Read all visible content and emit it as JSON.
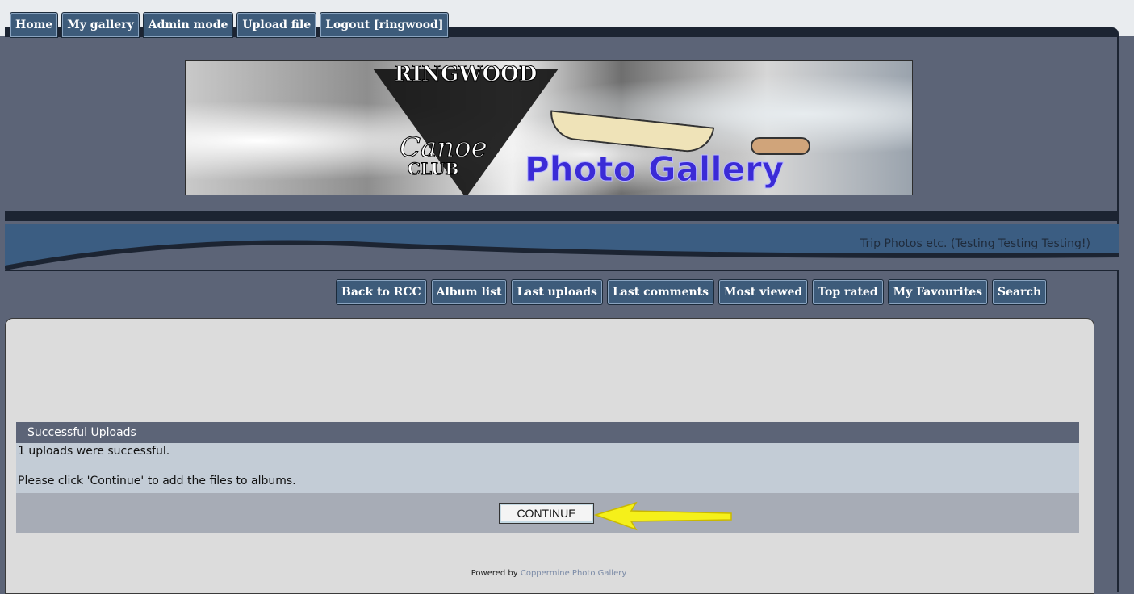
{
  "top_nav": {
    "items": [
      "Home",
      "My gallery",
      "Admin mode",
      "Upload file",
      "Logout [ringwood]"
    ]
  },
  "banner": {
    "brand_top": "RINGWOOD",
    "brand_canoe": "Canoe",
    "brand_club": "CLUB",
    "title": "Photo Gallery"
  },
  "tagline": "Trip Photos etc. (Testing Testing Testing!)",
  "sub_nav": {
    "items": [
      "Back to RCC",
      "Album list",
      "Last uploads",
      "Last comments",
      "Most viewed",
      "Top rated",
      "My Favourites",
      "Search"
    ]
  },
  "upload_panel": {
    "heading": "Successful Uploads",
    "message1": "1 uploads were successful.",
    "message2": "Please click 'Continue' to add the files to albums.",
    "continue_label": "CONTINUE"
  },
  "footer": {
    "powered_prefix": "Powered by ",
    "powered_link": "Coppermine Photo Gallery"
  },
  "colors": {
    "tab_bg": "#3d5b7a",
    "frame_bg": "#5c6477",
    "arrow": "#f5f01a"
  }
}
